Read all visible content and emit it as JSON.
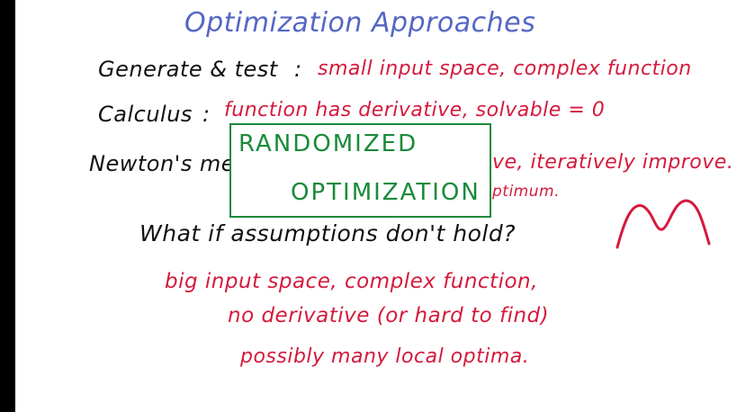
{
  "board": {
    "title": "Optimization Approaches",
    "rows": [
      {
        "label": "Generate & test",
        "sep": ":",
        "note": "small input space, complex function"
      },
      {
        "label": "Calculus",
        "sep": ":",
        "note": "function has derivative, solvable = 0"
      },
      {
        "label": "Newton's me",
        "note_right": "ve, iteratively improve.",
        "note_right2": "ptimum."
      }
    ],
    "box": {
      "line1": "RANDOMIZED",
      "line2": "OPTIMIZATION"
    },
    "question": "What if assumptions don't hold?",
    "answers": [
      "big input space, complex function,",
      "no derivative (or hard to find)",
      "possibly many local optima."
    ]
  },
  "colors": {
    "title": "#5567c4",
    "black_ink": "#111111",
    "red_ink": "#d41a3c",
    "green_ink": "#1a8a3a"
  },
  "icons": {
    "wave": "wave-sketch-icon"
  }
}
